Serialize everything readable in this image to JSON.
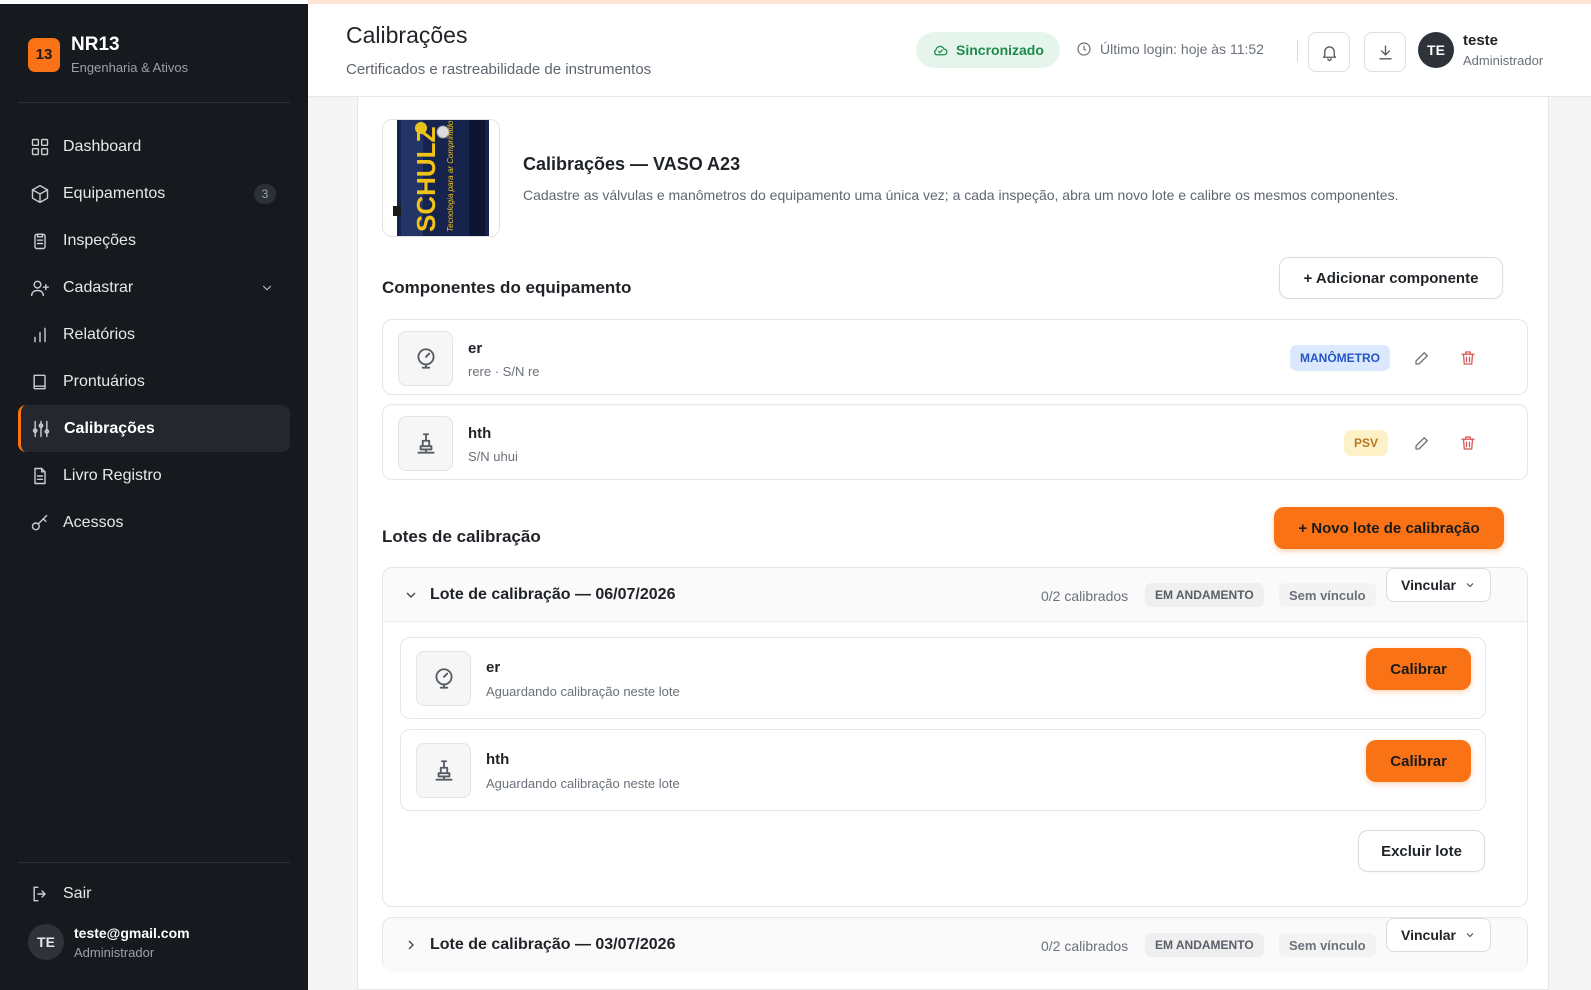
{
  "brand": {
    "logo": "13",
    "name": "NR13",
    "subtitle": "Engenharia & Ativos"
  },
  "sidebar": {
    "items": [
      {
        "label": "Dashboard",
        "icon": "grid-icon"
      },
      {
        "label": "Equipamentos",
        "icon": "box-icon",
        "badge": "3"
      },
      {
        "label": "Inspeções",
        "icon": "clipboard-icon"
      },
      {
        "label": "Cadastrar",
        "icon": "user-plus-icon"
      },
      {
        "label": "Relatórios",
        "icon": "bar-chart-icon"
      },
      {
        "label": "Prontuários",
        "icon": "book-icon"
      },
      {
        "label": "Calibrações",
        "icon": "sliders-icon",
        "active": true
      },
      {
        "label": "Livro Registro",
        "icon": "file-text-icon"
      },
      {
        "label": "Acessos",
        "icon": "key-icon"
      }
    ],
    "logout": "Sair",
    "user": {
      "initials": "TE",
      "email": "teste@gmail.com",
      "role": "Administrador"
    }
  },
  "header": {
    "title": "Calibrações",
    "subtitle": "Certificados e rastreabilidade de instrumentos",
    "sync": "Sincronizado",
    "last_login": "Último login: hoje às 11:52",
    "user": {
      "initials": "TE",
      "name": "teste",
      "role": "Administrador"
    }
  },
  "equipment": {
    "title": "Calibrações — VASO A23",
    "description": "Cadastre as válvulas e manômetros do equipamento uma única vez; a cada inspeção, abra um novo lote e calibre os mesmos componentes.",
    "brand_mark": "SCHULZ",
    "tagline": "Tecnologia para ar Comprimido"
  },
  "components": {
    "title": "Componentes do equipamento",
    "add_label": "+ Adicionar componente",
    "items": [
      {
        "name": "er",
        "meta": "rere · S/N re",
        "badge": "MANÔMETRO",
        "icon": "gauge-icon"
      },
      {
        "name": "hth",
        "meta": "S/N uhui",
        "badge": "PSV",
        "icon": "valve-icon"
      }
    ]
  },
  "lotes": {
    "title": "Lotes de calibração",
    "new_label": "+ Novo lote de calibração",
    "items": [
      {
        "title": "Lote de calibração — 06/07/2026",
        "count": "0/2 calibrados",
        "status": "EM ANDAMENTO",
        "link": "Sem vínculo",
        "vincular": "Vincular",
        "entries": [
          {
            "name": "er",
            "status": "Aguardando calibração neste lote",
            "action": "Calibrar"
          },
          {
            "name": "hth",
            "status": "Aguardando calibração neste lote",
            "action": "Calibrar"
          }
        ],
        "delete_label": "Excluir lote"
      },
      {
        "title": "Lote de calibração — 03/07/2026",
        "count": "0/2 calibrados",
        "status": "EM ANDAMENTO",
        "link": "Sem vínculo",
        "vincular": "Vincular"
      }
    ]
  },
  "colors": {
    "accent": "#f97316",
    "sidebar_bg": "#16191d",
    "success": "#1e8a4c",
    "danger": "#d9534f"
  }
}
